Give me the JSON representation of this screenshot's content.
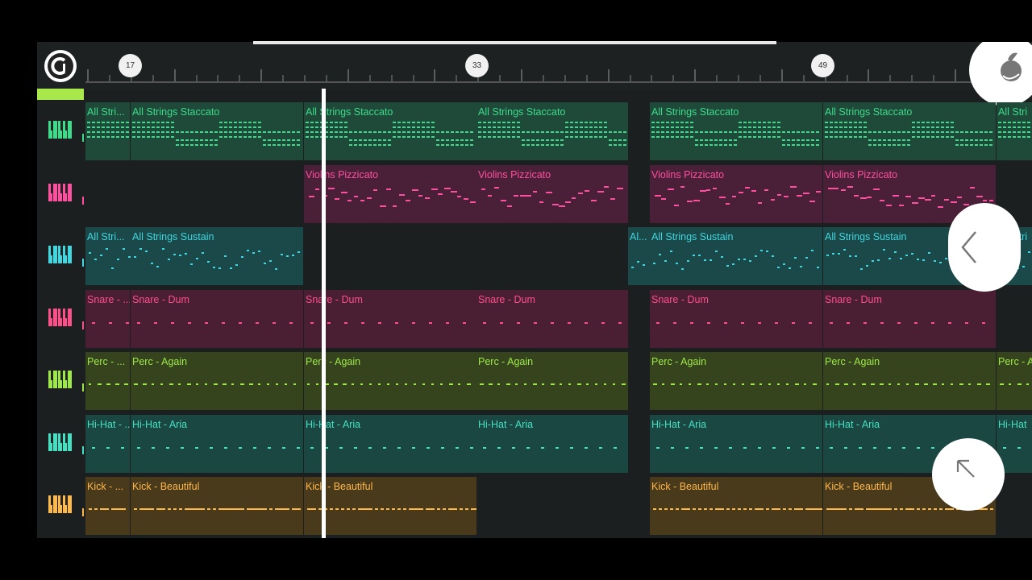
{
  "timeline": {
    "markers": [
      {
        "label": "17"
      },
      {
        "label": "33"
      },
      {
        "label": "49"
      }
    ]
  },
  "tracks": [
    {
      "name": "All Strings Staccato",
      "color": "#3ddc8a",
      "bg": "#1f4a3a",
      "patterns": [
        "All Stri...",
        "All Strings Staccato",
        "All Strings Staccato",
        "All Strings Staccato",
        "All Strings Staccato",
        "All Strings Staccato",
        "All Stri"
      ]
    },
    {
      "name": "Violins Pizzicato",
      "color": "#ff4fa0",
      "bg": "#4a1f38",
      "patterns": [
        "Violins Pizzicato",
        "Violins Pizzicato",
        "Violins Pizzicato",
        "Violins Pizzicato"
      ]
    },
    {
      "name": "All Strings Sustain",
      "color": "#3fd7e0",
      "bg": "#1b4848",
      "patterns": [
        "All Stri...",
        "All Strings Sustain",
        "Al...",
        "All Strings Sustain",
        "All Strings Sustain",
        "All Stri"
      ]
    },
    {
      "name": "Snare - Dum",
      "color": "#ff4f8a",
      "bg": "#4a1f33",
      "patterns": [
        "Snare - ...",
        "Snare - Dum",
        "Snare - Dum",
        "Snare - Dum",
        "Snare - Dum",
        "Snare - Dum"
      ]
    },
    {
      "name": "Perc - Again",
      "color": "#9ee84a",
      "bg": "#35441c",
      "patterns": [
        "Perc - ...",
        "Perc - Again",
        "Perc - Again",
        "Perc - Again",
        "Perc - Again",
        "Perc - Again",
        "Perc - A"
      ]
    },
    {
      "name": "Hi-Hat - Aria",
      "color": "#44e0c4",
      "bg": "#1b4742",
      "patterns": [
        "Hi-Hat - ...",
        "Hi-Hat - Aria",
        "Hi-Hat - Aria",
        "Hi-Hat - Aria",
        "Hi-Hat - Aria",
        "Hi-Hat - Aria",
        "Hi-Hat"
      ]
    },
    {
      "name": "Kick - Beautiful",
      "color": "#ffb84a",
      "bg": "#4a3a1c",
      "patterns": [
        "Kick - ...",
        "Kick - Beautiful",
        "Kick - Beautiful",
        "Kick - Beautiful",
        "Kick - Beautiful"
      ]
    }
  ],
  "icons": {
    "logo": "fl-logo-icon",
    "corner": "fl-fruit-icon",
    "back": "chevron-left-icon",
    "expand": "arrow-up-left-icon"
  }
}
